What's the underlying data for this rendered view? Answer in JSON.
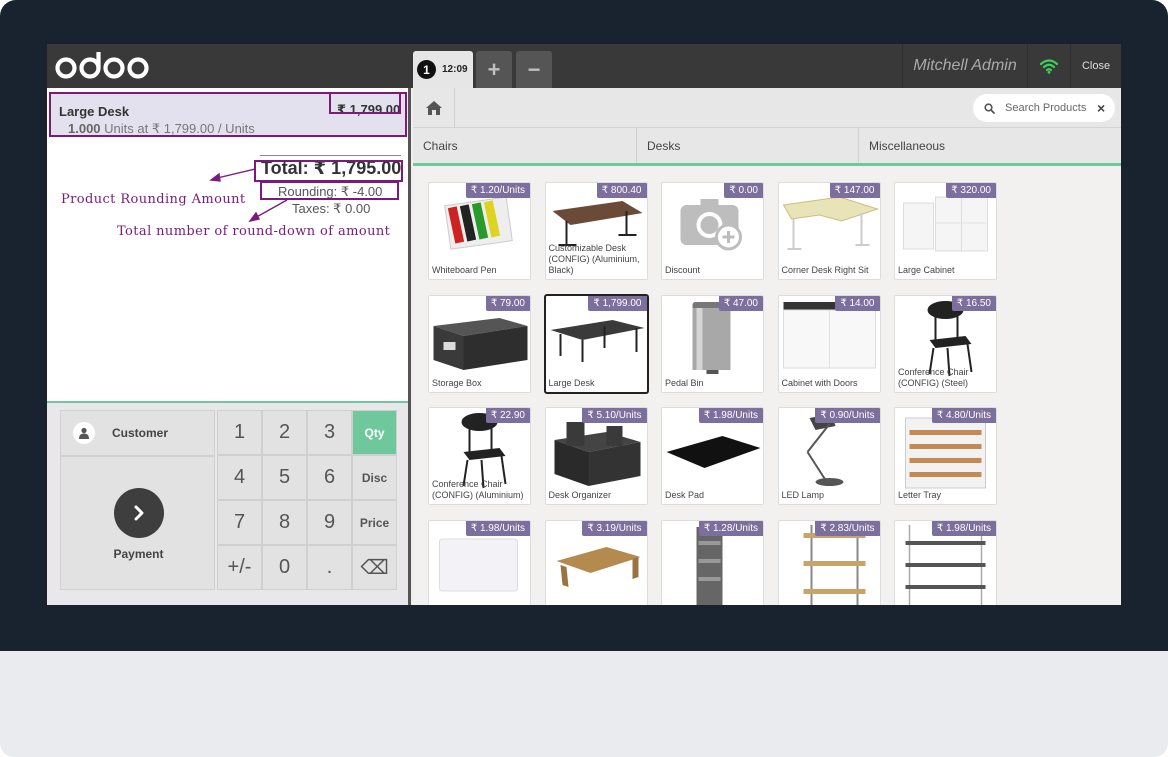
{
  "header": {
    "logo_text": "odoo",
    "order_number": "1",
    "order_time": "12:09",
    "add_order_label": "+",
    "remove_order_label": "−",
    "user_name": "Mitchell Admin",
    "close_label": "Close"
  },
  "order": {
    "line_product": "Large Desk",
    "line_price": "₹ 1,799.00",
    "line_qty": "1.000",
    "line_unit_info": "Units at ₹ 1,799.00 / Units",
    "total": "Total: ₹ 1,795.00",
    "rounding": "Rounding: ₹ -4.00",
    "taxes": "Taxes: ₹ 0.00"
  },
  "annotations": {
    "product_rounding": "Product Rounding Amount",
    "round_down": "Total number of round-down of amount"
  },
  "actions": {
    "customer_label": "Customer",
    "payment_label": "Payment"
  },
  "numpad": {
    "keys": [
      "1",
      "2",
      "3",
      "Qty",
      "4",
      "5",
      "6",
      "Disc",
      "7",
      "8",
      "9",
      "Price",
      "+/-",
      "0",
      ".",
      "⌫"
    ],
    "active_mode": "Qty"
  },
  "search": {
    "placeholder": "Search Products",
    "clear_icon": "×"
  },
  "categories": [
    "Chairs",
    "Desks",
    "Miscellaneous"
  ],
  "products": [
    {
      "name": "Whiteboard Pen",
      "price": "₹ 1.20/Units",
      "icon": "whiteboard-pen-image"
    },
    {
      "name": "Customizable Desk (CONFIG) (Aluminium, Black)",
      "price": "₹ 800.40",
      "icon": "customizable-desk-image"
    },
    {
      "name": "Discount",
      "price": "₹ 0.00",
      "icon": "camera-placeholder-image"
    },
    {
      "name": "Corner Desk Right Sit",
      "price": "₹ 147.00",
      "icon": "corner-desk-image"
    },
    {
      "name": "Large Cabinet",
      "price": "₹ 320.00",
      "icon": "large-cabinet-image"
    },
    {
      "name": "Storage Box",
      "price": "₹ 79.00",
      "icon": "storage-box-image"
    },
    {
      "name": "Large Desk",
      "price": "₹ 1,799.00",
      "icon": "large-desk-image",
      "selected": true
    },
    {
      "name": "Pedal Bin",
      "price": "₹ 47.00",
      "icon": "pedal-bin-image"
    },
    {
      "name": "Cabinet with Doors",
      "price": "₹ 14.00",
      "icon": "cabinet-doors-image"
    },
    {
      "name": "Conference Chair (CONFIG) (Steel)",
      "price": "₹ 16.50",
      "icon": "conference-chair-image"
    },
    {
      "name": "Conference Chair (CONFIG) (Aluminium)",
      "price": "₹ 22.90",
      "icon": "conference-chair-image"
    },
    {
      "name": "Desk Organizer",
      "price": "₹ 5.10/Units",
      "icon": "desk-organizer-image"
    },
    {
      "name": "Desk Pad",
      "price": "₹ 1.98/Units",
      "icon": "desk-pad-image"
    },
    {
      "name": "LED Lamp",
      "price": "₹ 0.90/Units",
      "icon": "led-lamp-image"
    },
    {
      "name": "Letter Tray",
      "price": "₹ 4.80/Units",
      "icon": "letter-tray-image"
    },
    {
      "name": "",
      "price": "₹ 1.98/Units",
      "icon": "magnetic-board-image"
    },
    {
      "name": "",
      "price": "₹ 3.19/Units",
      "icon": "monitor-stand-image"
    },
    {
      "name": "",
      "price": "₹ 1.28/Units",
      "icon": "newspaper-rack-image"
    },
    {
      "name": "",
      "price": "₹ 2.83/Units",
      "icon": "small-shelf-image"
    },
    {
      "name": "",
      "price": "₹ 1.98/Units",
      "icon": "wall-shelf-image"
    }
  ],
  "colors": {
    "accent_green": "#6ec89b",
    "price_tag": "#7c6f9e",
    "annotation": "#7b1a7d",
    "header": "#393939"
  }
}
